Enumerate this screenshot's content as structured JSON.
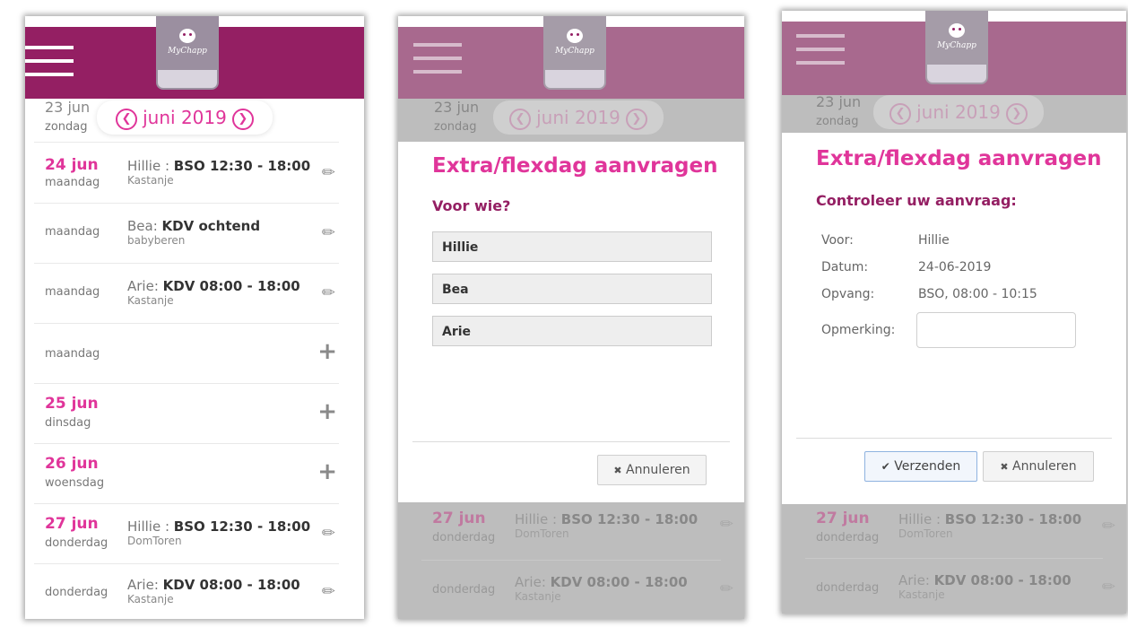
{
  "brand": {
    "logo_text": "MyChapp"
  },
  "month_nav": {
    "prev_icon": "chevron-left-circle",
    "label": "juni 2019",
    "next_icon": "chevron-right-circle"
  },
  "top_row": {
    "date": "23 jun",
    "day": "zondag"
  },
  "agenda": [
    {
      "date": "24 jun",
      "day": "maandag",
      "child": "Hillie : ",
      "booking": "BSO 12:30 - 18:00",
      "location": "Kastanje",
      "action": "edit"
    },
    {
      "date": "",
      "day": "maandag",
      "child": "Bea: ",
      "booking": "KDV ochtend",
      "location": "babyberen",
      "action": "edit"
    },
    {
      "date": "",
      "day": "maandag",
      "child": "Arie: ",
      "booking": "KDV 08:00 - 18:00",
      "location": "Kastanje",
      "action": "edit"
    },
    {
      "date": "",
      "day": "maandag",
      "child": "",
      "booking": "",
      "location": "",
      "action": "add"
    },
    {
      "date": "25 jun",
      "day": "dinsdag",
      "child": "",
      "booking": "",
      "location": "",
      "action": "add"
    },
    {
      "date": "26 jun",
      "day": "woensdag",
      "child": "",
      "booking": "",
      "location": "",
      "action": "add"
    },
    {
      "date": "27 jun",
      "day": "donderdag",
      "child": "Hillie : ",
      "booking": "BSO 12:30 - 18:00",
      "location": "DomToren",
      "action": "edit"
    },
    {
      "date": "",
      "day": "donderdag",
      "child": "Arie: ",
      "booking": "KDV 08:00 - 18:00",
      "location": "Kastanje",
      "action": "edit"
    }
  ],
  "modal_select": {
    "title": "Extra/flexdag aanvragen",
    "question": "Voor wie?",
    "options": [
      "Hillie",
      "Bea",
      "Arie"
    ],
    "cancel": "Annuleren"
  },
  "modal_confirm": {
    "title": "Extra/flexdag aanvragen",
    "heading": "Controleer uw aanvraag:",
    "fields": [
      {
        "label": "Voor:",
        "value": "Hillie"
      },
      {
        "label": "Datum:",
        "value": "24-06-2019"
      },
      {
        "label": "Opvang:",
        "value": "BSO, 08:00 - 10:15"
      },
      {
        "label": "Opmerking:",
        "value": ""
      }
    ],
    "submit": "Verzenden",
    "cancel": "Annuleren"
  },
  "colors": {
    "header": "#941f63",
    "accent": "#e0359a",
    "overlay": "#6e6e6e"
  },
  "icons": {
    "menu": "hamburger-icon",
    "edit": "pencil-icon",
    "add": "plus-icon",
    "check": "check-icon",
    "close": "x-icon"
  }
}
